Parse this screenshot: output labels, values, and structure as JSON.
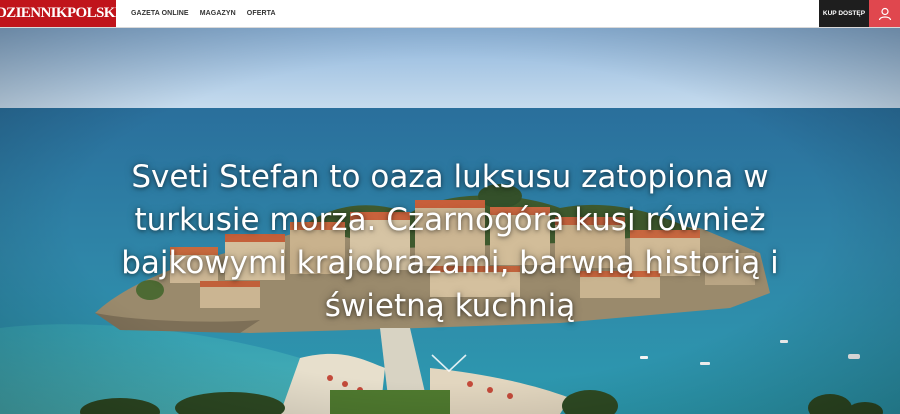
{
  "header": {
    "logo_text": "DziennikPolski",
    "nav": [
      {
        "label": "GAZETA ONLINE"
      },
      {
        "label": "MAGAZYN"
      },
      {
        "label": "OFERTA"
      }
    ],
    "subscribe_label": "KUP DOSTĘP",
    "user_icon": "user-icon",
    "colors": {
      "brand": "#c0141b",
      "subscribe_bg": "#1e1e1e",
      "user_bg": "#e0474e"
    }
  },
  "hero": {
    "headline": "Sveti Stefan to oaza luksusu zatopiona w turkusie morza. Czarnogóra kusi również bajkowymi krajobrazami, barwną historią i świetną kuchnią",
    "scroll_icon": "chevron-down-icon"
  }
}
